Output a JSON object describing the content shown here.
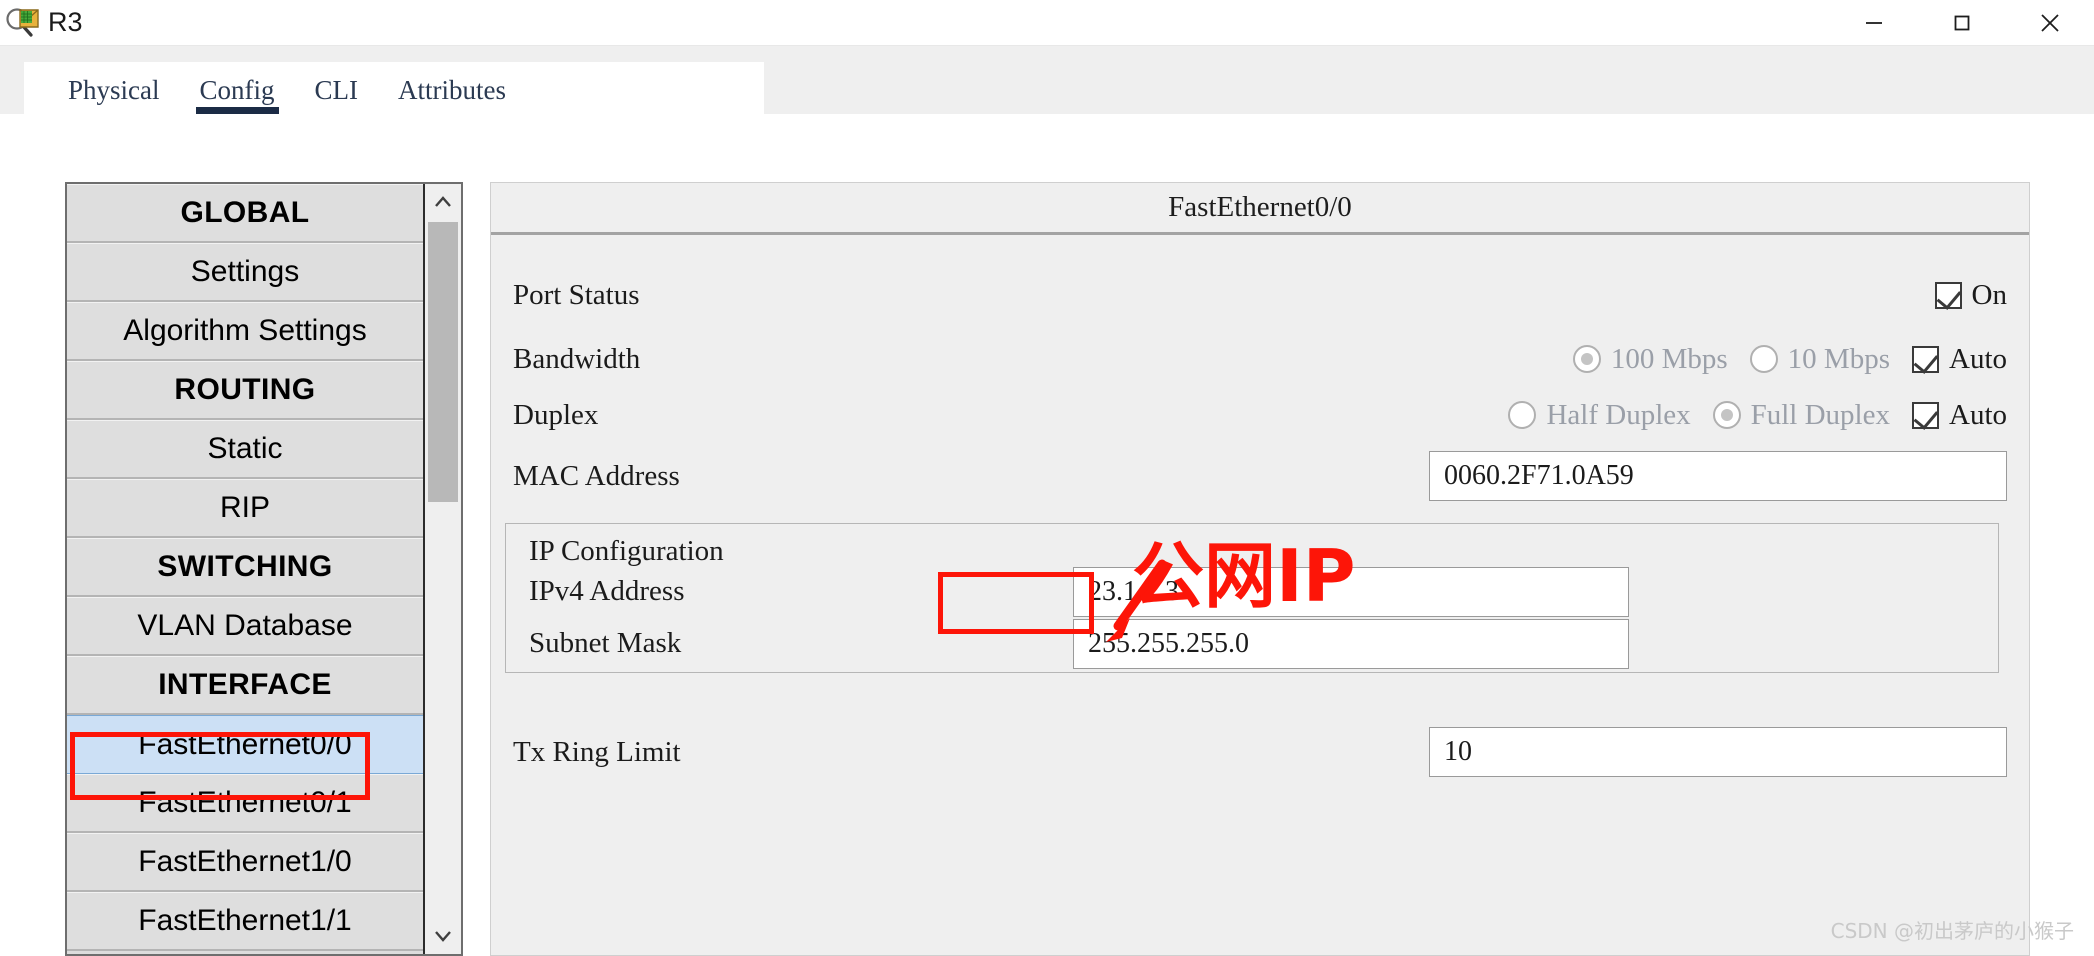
{
  "window": {
    "title": "R3",
    "icon": "router-magnifier-icon",
    "controls": {
      "minimize": "—",
      "maximize": "□",
      "close": "✕"
    }
  },
  "tabs": [
    {
      "label": "Physical",
      "active": false
    },
    {
      "label": "Config",
      "active": true
    },
    {
      "label": "CLI",
      "active": false
    },
    {
      "label": "Attributes",
      "active": false
    }
  ],
  "sidebar": {
    "items": [
      {
        "label": "GLOBAL",
        "type": "header",
        "selected": false
      },
      {
        "label": "Settings",
        "type": "item",
        "selected": false
      },
      {
        "label": "Algorithm Settings",
        "type": "item",
        "selected": false
      },
      {
        "label": "ROUTING",
        "type": "header",
        "selected": false
      },
      {
        "label": "Static",
        "type": "item",
        "selected": false
      },
      {
        "label": "RIP",
        "type": "item",
        "selected": false
      },
      {
        "label": "SWITCHING",
        "type": "header",
        "selected": false
      },
      {
        "label": "VLAN Database",
        "type": "item",
        "selected": false
      },
      {
        "label": "INTERFACE",
        "type": "header",
        "selected": false
      },
      {
        "label": "FastEthernet0/0",
        "type": "item",
        "selected": true
      },
      {
        "label": "FastEthernet0/1",
        "type": "item",
        "selected": false
      },
      {
        "label": "FastEthernet1/0",
        "type": "item",
        "selected": false
      },
      {
        "label": "FastEthernet1/1",
        "type": "item",
        "selected": false
      }
    ],
    "scrollbar": {
      "up": "▲",
      "down": "▼"
    }
  },
  "panel": {
    "title": "FastEthernet0/0",
    "port_status": {
      "label": "Port Status",
      "on_label": "On",
      "on_checked": true
    },
    "bandwidth": {
      "label": "Bandwidth",
      "options": [
        {
          "label": "100 Mbps",
          "selected": true
        },
        {
          "label": "10 Mbps",
          "selected": false
        }
      ],
      "auto_label": "Auto",
      "auto_checked": true
    },
    "duplex": {
      "label": "Duplex",
      "options": [
        {
          "label": "Half Duplex",
          "selected": false
        },
        {
          "label": "Full Duplex",
          "selected": true
        }
      ],
      "auto_label": "Auto",
      "auto_checked": true
    },
    "mac": {
      "label": "MAC Address",
      "value": "0060.2F71.0A59"
    },
    "ip_config": {
      "group_label": "IP Configuration",
      "ipv4_label": "IPv4 Address",
      "ipv4_value": "23.1.1.3",
      "mask_label": "Subnet Mask",
      "mask_value": "255.255.255.0"
    },
    "tx_ring": {
      "label": "Tx Ring Limit",
      "value": "10"
    }
  },
  "annotations": {
    "public_ip_text": "公网IP",
    "accent_color": "#fd1508",
    "selected_color": "#cce0f5"
  },
  "watermark": "CSDN @初出茅庐的小猴子"
}
